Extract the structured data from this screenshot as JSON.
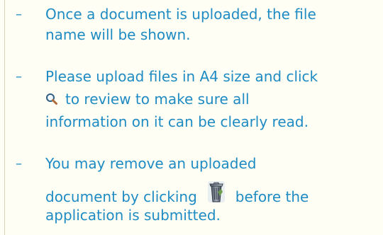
{
  "notes": [
    {
      "bullet": "–",
      "lines": [
        "Once a document is uploaded, the file",
        "name will be shown."
      ]
    },
    {
      "bullet": "–",
      "lines": [
        "Please upload files in A4 size and click",
        "to review to make sure all",
        "information on it can be clearly read."
      ],
      "icon": "search-icon"
    },
    {
      "bullet": "–",
      "lines": [
        "You may remove an uploaded",
        "document by clicking",
        "before the",
        "application is submitted."
      ],
      "icon": "trash-icon"
    }
  ],
  "colors": {
    "text": "#1f8bc3",
    "background": "#fffef5",
    "border": "#d9d4b3"
  }
}
